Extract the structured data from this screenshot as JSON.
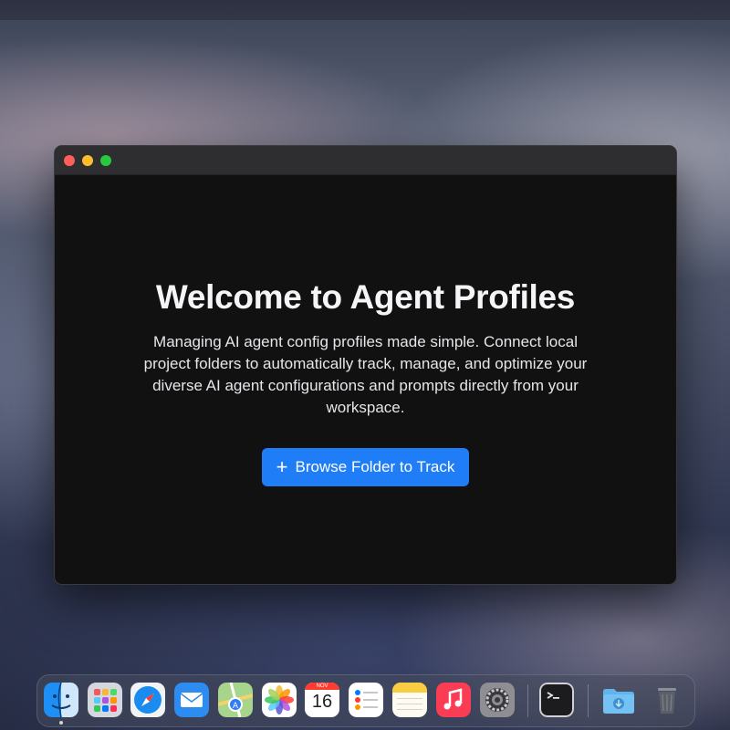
{
  "window": {
    "title": "",
    "welcome_title": "Welcome to Agent Profiles",
    "welcome_description": "Managing AI agent config profiles made simple. Connect local project folders to automatically track, manage, and optimize your diverse AI agent configurations and prompts directly from your workspace.",
    "browse_button_label": "Browse Folder to Track",
    "browse_button_icon": "plus-icon",
    "accent_color": "#1f7ef7"
  },
  "dock": {
    "items": [
      {
        "name": "finder-icon"
      },
      {
        "name": "launchpad-icon"
      },
      {
        "name": "safari-icon"
      },
      {
        "name": "mail-icon"
      },
      {
        "name": "maps-icon"
      },
      {
        "name": "photos-icon"
      },
      {
        "name": "calendar-icon",
        "month": "NOV",
        "day": "16"
      },
      {
        "name": "reminders-icon"
      },
      {
        "name": "notes-icon"
      },
      {
        "name": "music-icon"
      },
      {
        "name": "system-settings-icon"
      },
      {
        "name": "terminal-icon"
      },
      {
        "name": "downloads-folder-icon"
      },
      {
        "name": "trash-icon"
      }
    ]
  }
}
